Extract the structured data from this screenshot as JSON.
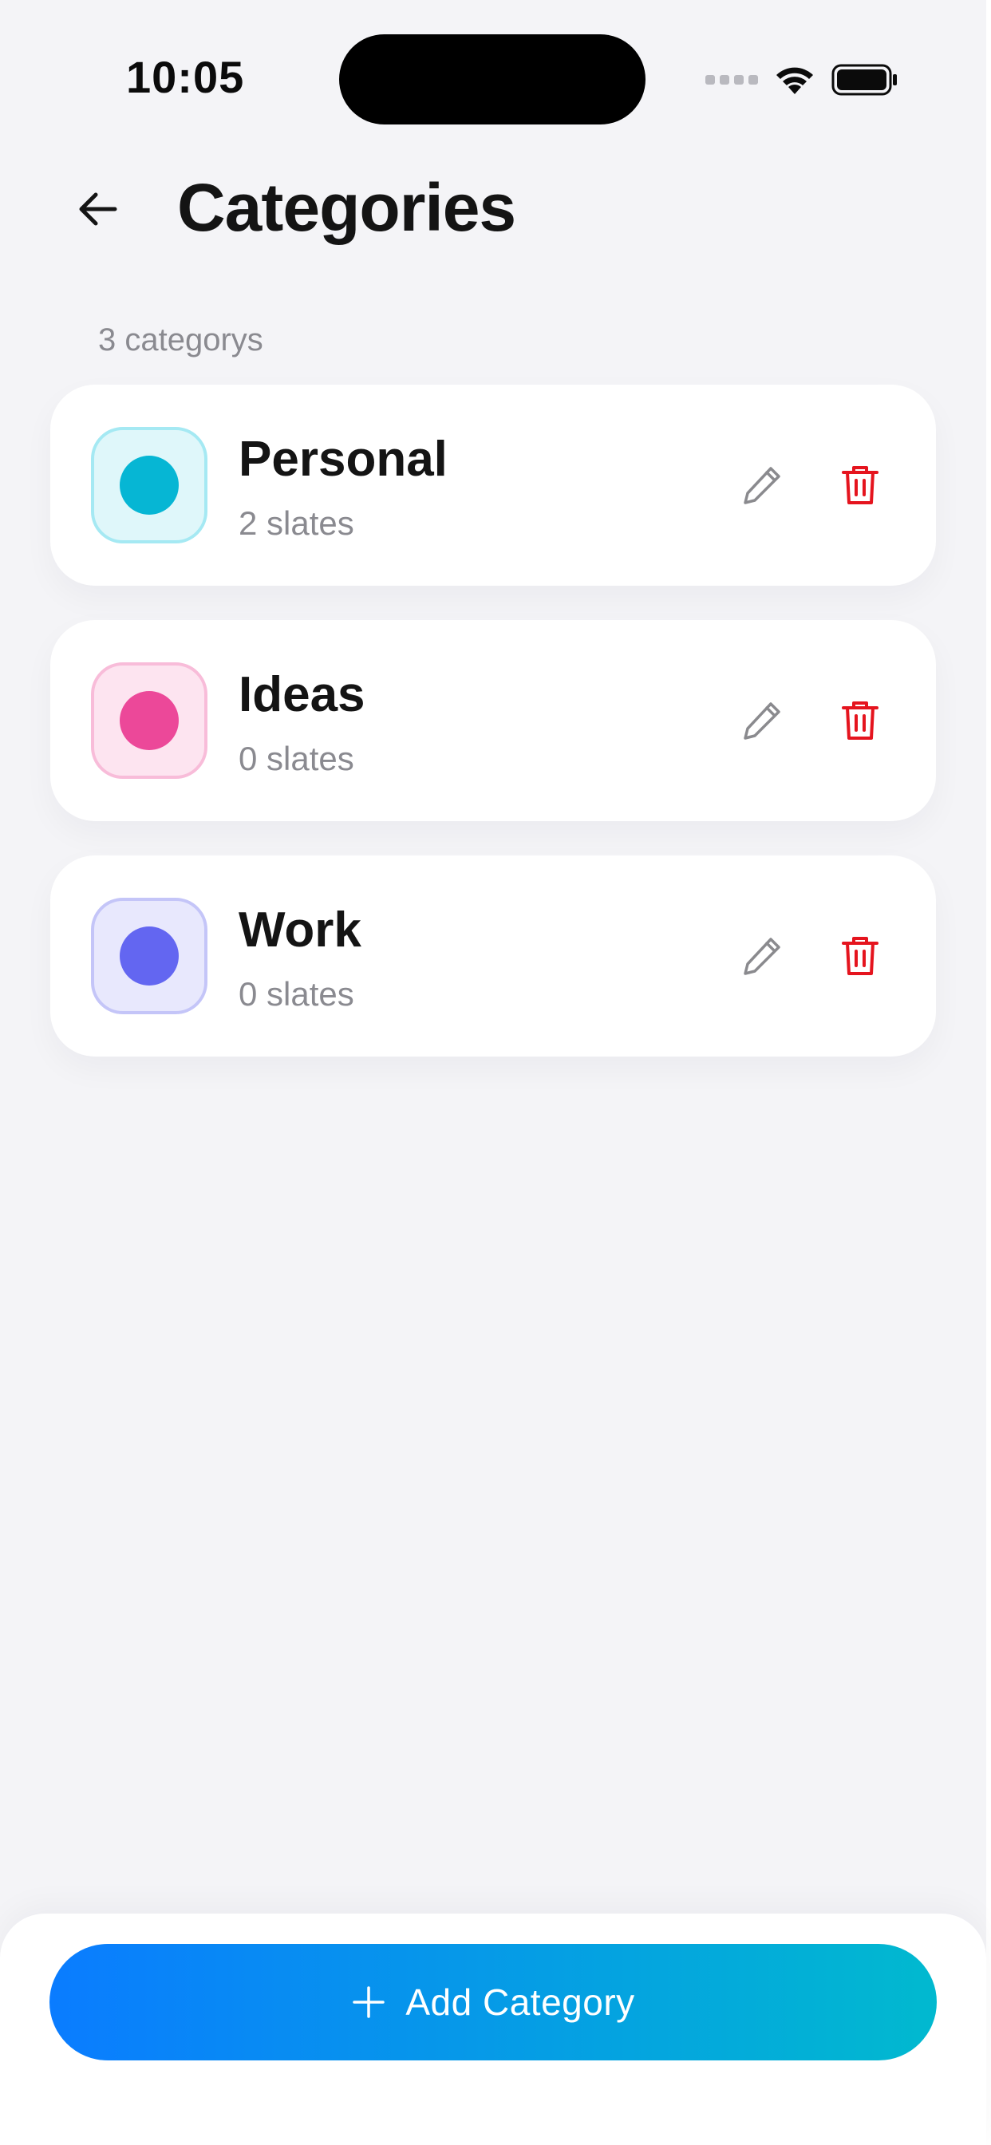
{
  "status_bar": {
    "time": "10:05"
  },
  "header": {
    "title": "Categories",
    "back_icon": "arrow-left-icon"
  },
  "summary": {
    "count_label": "3 categorys"
  },
  "categories": [
    {
      "name": "Personal",
      "subtitle": "2 slates",
      "color": "#06b6d4",
      "swatch_bg": "#dff7fa",
      "swatch_border": "#a5e9f3"
    },
    {
      "name": "Ideas",
      "subtitle": "0 slates",
      "color": "#ec4899",
      "swatch_bg": "#fde4f0",
      "swatch_border": "#f8bcd9"
    },
    {
      "name": "Work",
      "subtitle": "0 slates",
      "color": "#6366f1",
      "swatch_bg": "#e8e8fd",
      "swatch_border": "#c4c5f8"
    }
  ],
  "actions": {
    "edit_icon": "pencil-icon",
    "edit_color": "#8a8a8e",
    "delete_icon": "trash-icon",
    "delete_color": "#e5141e"
  },
  "footer": {
    "add_label": "Add Category",
    "add_icon": "plus-icon",
    "gradient_start": "#0a7cff",
    "gradient_end": "#01b9cf"
  }
}
